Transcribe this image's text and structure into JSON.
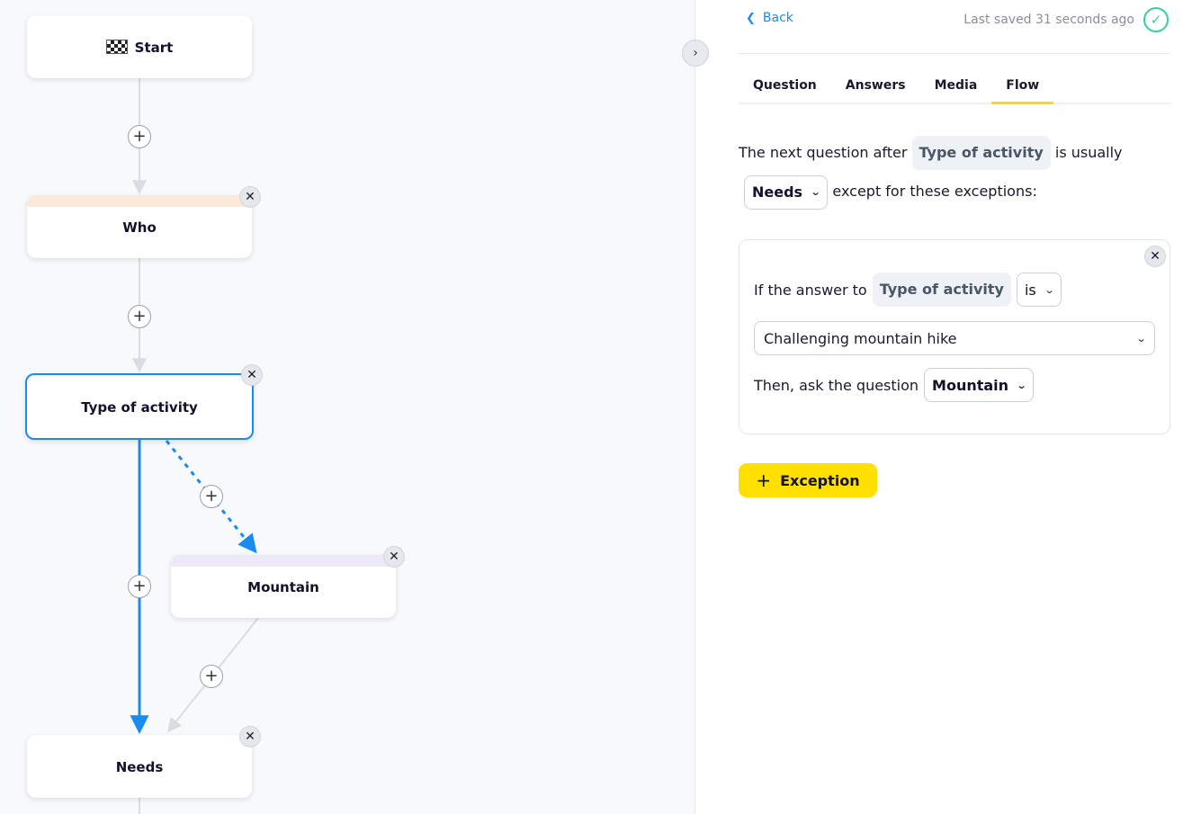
{
  "canvas": {
    "nodes": {
      "start": {
        "label": "Start"
      },
      "who": {
        "label": "Who"
      },
      "type": {
        "label": "Type of activity"
      },
      "mountain": {
        "label": "Mountain"
      },
      "needs": {
        "label": "Needs"
      }
    },
    "close_glyph": "✕",
    "plus_glyph": "+",
    "collapse_glyph": "›"
  },
  "panel": {
    "back_label": "Back",
    "saved_text": "Last saved 31 seconds ago",
    "tabs": [
      {
        "label": "Question"
      },
      {
        "label": "Answers"
      },
      {
        "label": "Media"
      },
      {
        "label": "Flow"
      }
    ],
    "active_tab": "Flow",
    "flow": {
      "prefix": "The next question after",
      "question_chip": "Type of activity",
      "middle": "is usually",
      "default_next": "Needs",
      "suffix": "except for these exceptions:",
      "exception": {
        "if_text": "If the answer to",
        "question_chip": "Type of activity",
        "operator": "is",
        "answer": "Challenging mountain hike",
        "then_text": "Then, ask the question",
        "target": "Mountain"
      },
      "add_exception_label": "Exception"
    }
  },
  "colors": {
    "accent_blue": "#1a8cf0",
    "accent_yellow": "#ffdc00",
    "success_green": "#2fd3a0",
    "who_stripe": "#fde9d9",
    "mountain_stripe": "#eee9f8"
  }
}
